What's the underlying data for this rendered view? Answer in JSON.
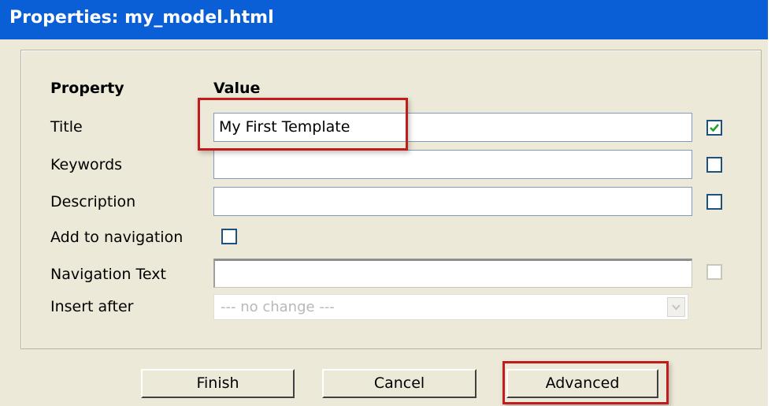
{
  "window": {
    "title": "Properties: my_model.html"
  },
  "table": {
    "header_property": "Property",
    "header_value": "Value"
  },
  "rows": {
    "title": {
      "label": "Title",
      "value": "My First Template",
      "checked": true
    },
    "keywords": {
      "label": "Keywords",
      "value": "",
      "checked": false
    },
    "description": {
      "label": "Description",
      "value": "",
      "checked": false
    },
    "add_to_navigation": {
      "label": "Add to navigation",
      "checked": false
    },
    "navigation_text": {
      "label": "Navigation Text",
      "value": "",
      "checked": false
    },
    "insert_after": {
      "label": "Insert after",
      "selected": "--- no change ---"
    }
  },
  "buttons": {
    "finish": "Finish",
    "cancel": "Cancel",
    "advanced": "Advanced"
  },
  "colors": {
    "titlebar": "#0a5fd6",
    "highlight": "#c21b1b",
    "checkmark": "#21a121"
  }
}
